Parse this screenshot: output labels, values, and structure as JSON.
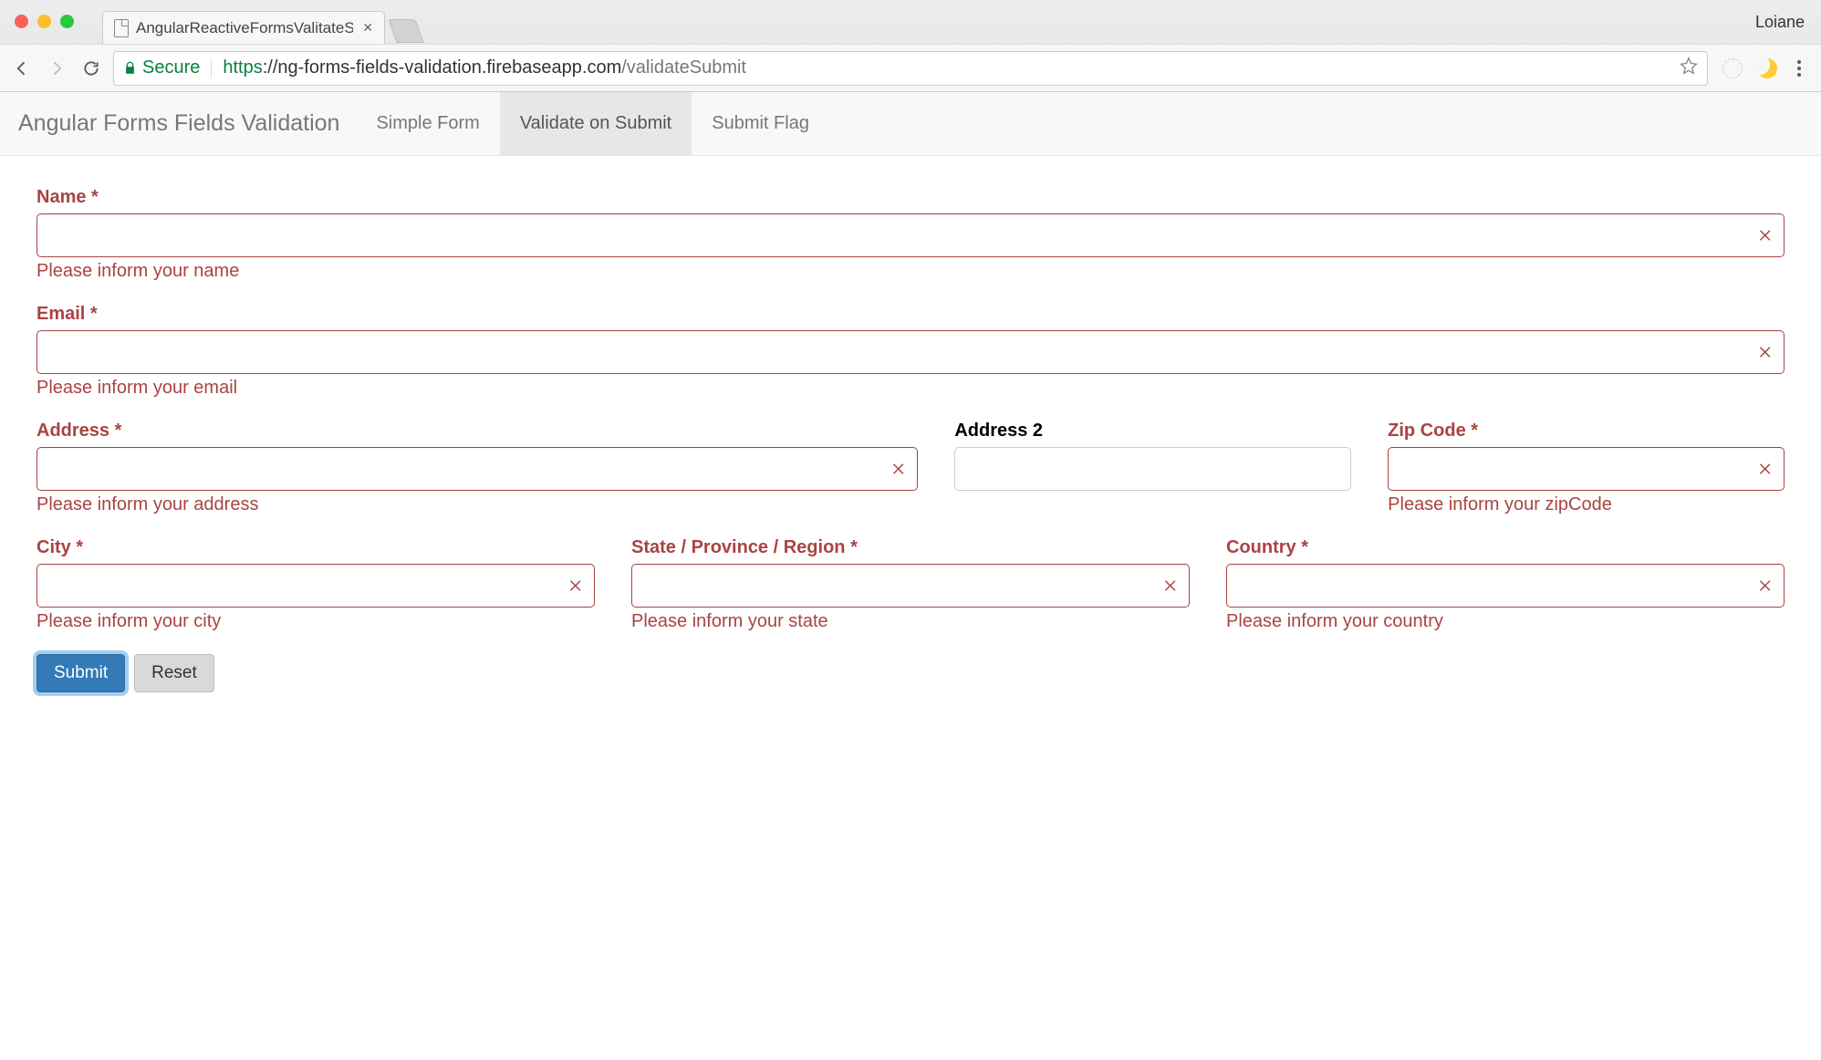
{
  "browser": {
    "tab_title": "AngularReactiveFormsValitateS",
    "profile_name": "Loiane",
    "secure_label": "Secure",
    "url_proto": "https",
    "url_host": "://ng-forms-fields-validation.firebaseapp.com",
    "url_path": "/validateSubmit"
  },
  "navbar": {
    "brand": "Angular Forms Fields Validation",
    "items": [
      {
        "label": "Simple Form",
        "active": false
      },
      {
        "label": "Validate on Submit",
        "active": true
      },
      {
        "label": "Submit Flag",
        "active": false
      }
    ]
  },
  "form": {
    "name": {
      "label": "Name",
      "required": "*",
      "value": "",
      "error": "Please inform your name"
    },
    "email": {
      "label": "Email",
      "required": "*",
      "value": "",
      "error": "Please inform your email"
    },
    "address": {
      "label": "Address",
      "required": "*",
      "value": "",
      "error": "Please inform your address"
    },
    "address2": {
      "label": "Address 2",
      "value": ""
    },
    "zip": {
      "label": "Zip Code",
      "required": "*",
      "value": "",
      "error": "Please inform your zipCode"
    },
    "city": {
      "label": "City",
      "required": "*",
      "value": "",
      "error": "Please inform your city"
    },
    "state": {
      "label": "State / Province / Region",
      "required": "*",
      "value": "",
      "error": "Please inform your state"
    },
    "country": {
      "label": "Country",
      "required": "*",
      "value": "",
      "error": "Please inform your country"
    },
    "submit_label": "Submit",
    "reset_label": "Reset"
  }
}
